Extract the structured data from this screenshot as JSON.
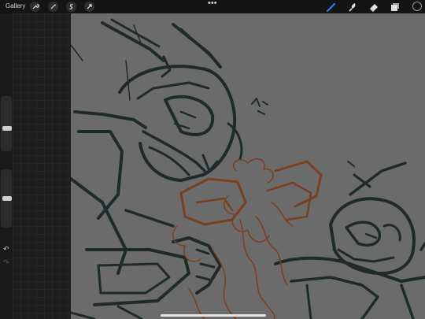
{
  "toolbar": {
    "gallery_label": "Gallery",
    "left_tools": [
      "wrench-icon",
      "magic-wand-icon",
      "selection-icon",
      "transform-arrow-icon"
    ],
    "menu_dots": "•••",
    "right_tools": [
      "brush-icon",
      "smudge-icon",
      "eraser-icon",
      "layers-icon"
    ],
    "active_tool": "brush-icon",
    "active_color": "#111111",
    "accent_color": "#2f7cf6"
  },
  "sidebar": {
    "brush_size": 0.4,
    "brush_opacity": 0.5,
    "undo_glyph": "↶",
    "redo_glyph": "↷"
  },
  "canvas": {
    "background_color": "#6b6b6b",
    "ink_color": "#1f2a2a",
    "sketch_color": "#7a3f1e"
  }
}
